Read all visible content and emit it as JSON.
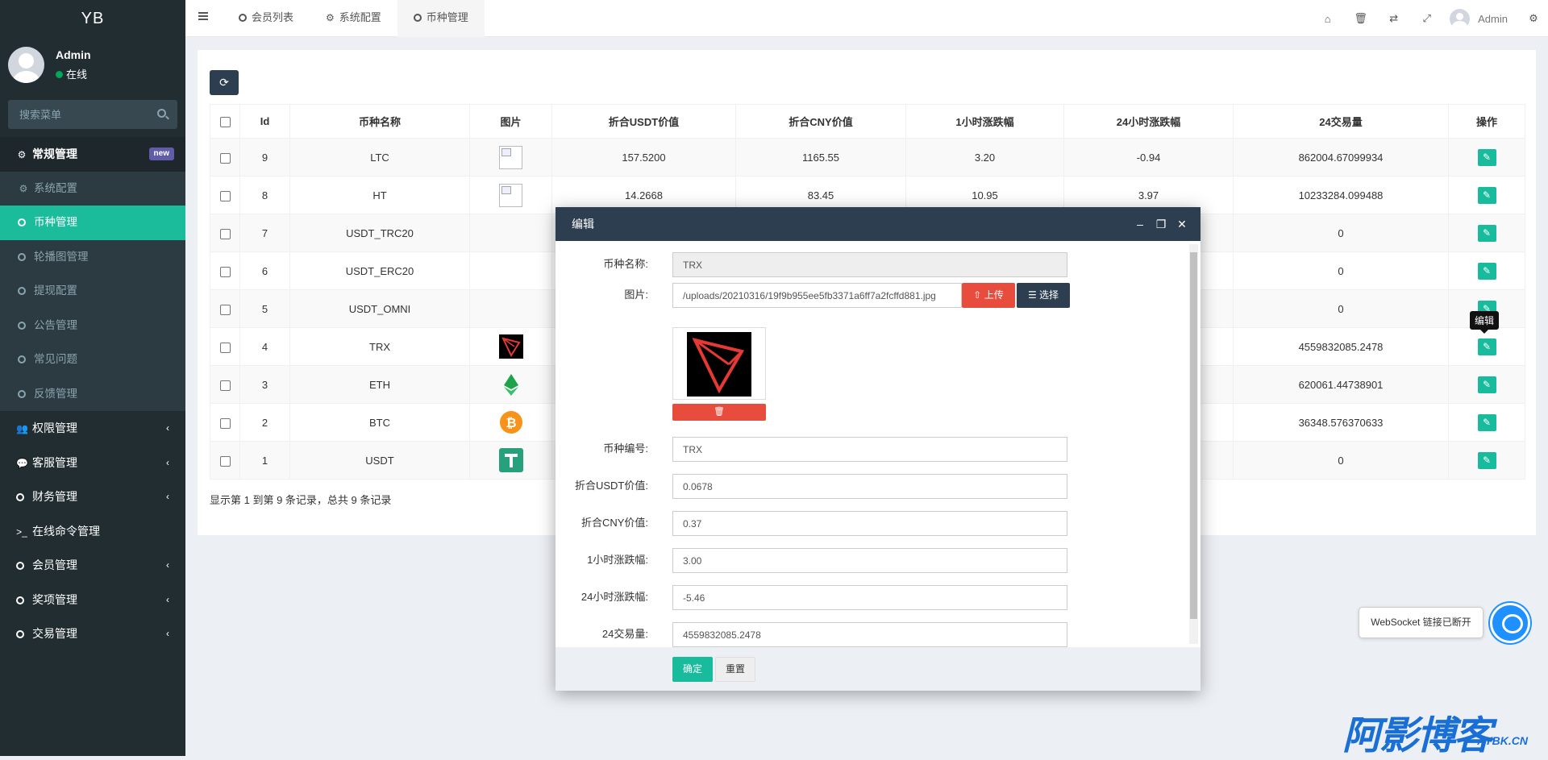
{
  "sidebar": {
    "logo": "YB",
    "user": {
      "name": "Admin",
      "status": "在线"
    },
    "search_placeholder": "搜索菜单",
    "menu": [
      {
        "label": "常规管理",
        "badge": "new"
      },
      {
        "label": "系统配置"
      },
      {
        "label": "币种管理"
      },
      {
        "label": "轮播图管理"
      },
      {
        "label": "提现配置"
      },
      {
        "label": "公告管理"
      },
      {
        "label": "常见问题"
      },
      {
        "label": "反馈管理"
      },
      {
        "label": "权限管理"
      },
      {
        "label": "客服管理"
      },
      {
        "label": "财务管理"
      },
      {
        "label": "在线命令管理"
      },
      {
        "label": "会员管理"
      },
      {
        "label": "奖项管理"
      },
      {
        "label": "交易管理"
      }
    ]
  },
  "header": {
    "tabs": [
      {
        "label": "会员列表"
      },
      {
        "label": "系统配置"
      },
      {
        "label": "币种管理"
      }
    ],
    "admin": "Admin"
  },
  "table": {
    "headers": [
      "Id",
      "币种名称",
      "图片",
      "折合USDT价值",
      "折合CNY价值",
      "1小时涨跌幅",
      "24小时涨跌幅",
      "24交易量",
      "操作"
    ],
    "rows": [
      {
        "id": "9",
        "name": "LTC",
        "img": "broken",
        "usdt": "157.5200",
        "cny": "1165.55",
        "h1": "3.20",
        "h24": "-0.94",
        "vol": "862004.67099934"
      },
      {
        "id": "8",
        "name": "HT",
        "img": "broken",
        "usdt": "14.2668",
        "cny": "83.45",
        "h1": "10.95",
        "h24": "3.97",
        "vol": "10233284.099488"
      },
      {
        "id": "7",
        "name": "USDT_TRC20",
        "img": "",
        "usdt": "",
        "cny": "",
        "h1": "",
        "h24": "",
        "vol": "0"
      },
      {
        "id": "6",
        "name": "USDT_ERC20",
        "img": "",
        "usdt": "",
        "cny": "",
        "h1": "",
        "h24": "",
        "vol": "0"
      },
      {
        "id": "5",
        "name": "USDT_OMNI",
        "img": "",
        "usdt": "",
        "cny": "",
        "h1": "",
        "h24": "",
        "vol": "0"
      },
      {
        "id": "4",
        "name": "TRX",
        "img": "trx",
        "usdt": "",
        "cny": "",
        "h1": "",
        "h24": "",
        "vol": "4559832085.2478"
      },
      {
        "id": "3",
        "name": "ETH",
        "img": "eth",
        "usdt": "",
        "cny": "",
        "h1": "",
        "h24": "",
        "vol": "620061.44738901"
      },
      {
        "id": "2",
        "name": "BTC",
        "img": "btc",
        "usdt": "",
        "cny": "",
        "h1": "",
        "h24": "",
        "vol": "36348.576370633"
      },
      {
        "id": "1",
        "name": "USDT",
        "img": "usdt",
        "usdt": "",
        "cny": "",
        "h1": "",
        "h24": "",
        "vol": "0"
      }
    ],
    "footer": "显示第 1 到第 9 条记录，总共 9 条记录"
  },
  "tooltip": "编辑",
  "dialog": {
    "title": "编辑",
    "fields": {
      "name_label": "币种名称:",
      "name_value": "TRX",
      "image_label": "图片:",
      "image_value": "/uploads/20210316/19f9b955ee5fb3371a6ff7a2fcffd881.jpg",
      "upload_btn": "上传",
      "select_btn": "选择",
      "code_label": "币种编号:",
      "code_value": "TRX",
      "usdt_label": "折合USDT价值:",
      "usdt_value": "0.0678",
      "cny_label": "折合CNY价值:",
      "cny_value": "0.37",
      "h1_label": "1小时涨跌幅:",
      "h1_value": "3.00",
      "h24_label": "24小时涨跌幅:",
      "h24_value": "-5.46",
      "vol_label": "24交易量:",
      "vol_value": "4559832085.2478"
    },
    "ok_btn": "确定",
    "reset_btn": "重置"
  },
  "toast": "WebSocket 链接已断开",
  "watermark": {
    "main": "阿影博客",
    "sub": "AYBK.CN"
  },
  "colors": {
    "sidebar": "#222d32",
    "active": "#1abc9c",
    "dialog_header": "#2c3e50",
    "danger": "#e74c3c"
  }
}
